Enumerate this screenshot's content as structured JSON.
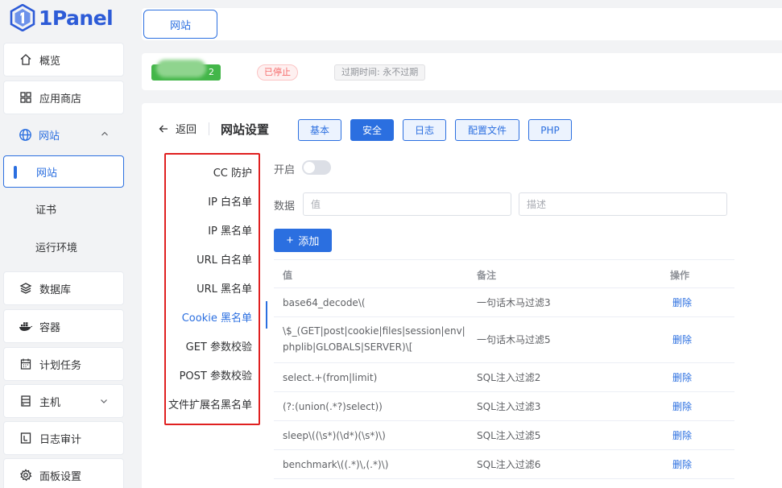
{
  "brand": {
    "name": "1Panel",
    "color": "#2d5bd7"
  },
  "sidebar": {
    "items": [
      {
        "label": "概览",
        "icon": "home-icon"
      },
      {
        "label": "应用商店",
        "icon": "grid-icon"
      },
      {
        "label": "网站",
        "icon": "globe-icon",
        "expanded": true
      },
      {
        "label": "数据库",
        "icon": "database-icon"
      },
      {
        "label": "容器",
        "icon": "docker-icon"
      },
      {
        "label": "计划任务",
        "icon": "calendar-icon"
      },
      {
        "label": "主机",
        "icon": "server-icon"
      },
      {
        "label": "日志审计",
        "icon": "log-icon"
      },
      {
        "label": "面板设置",
        "icon": "gear-icon"
      }
    ],
    "website_children": [
      {
        "label": "网站",
        "active": true
      },
      {
        "label": "证书"
      },
      {
        "label": "运行环境"
      }
    ]
  },
  "top_tab": {
    "label": "网站"
  },
  "site_info": {
    "tag_suffix": "2",
    "status": "已停止",
    "expire": "过期时间: 永不过期"
  },
  "header": {
    "back_label": "返回",
    "title": "网站设置",
    "tabs": [
      {
        "label": "基本",
        "active": false
      },
      {
        "label": "安全",
        "active": true
      },
      {
        "label": "日志",
        "active": false
      },
      {
        "label": "配置文件",
        "active": false
      },
      {
        "label": "PHP",
        "active": false
      }
    ]
  },
  "security_nav": [
    {
      "label": "CC 防护"
    },
    {
      "label": "IP 白名单"
    },
    {
      "label": "IP 黑名单"
    },
    {
      "label": "URL 白名单"
    },
    {
      "label": "URL 黑名单"
    },
    {
      "label": "Cookie 黑名单",
      "active": true
    },
    {
      "label": "GET 参数校验"
    },
    {
      "label": "POST 参数校验"
    },
    {
      "label": "文件扩展名黑名单"
    }
  ],
  "form": {
    "enable_label": "开启",
    "enabled": false,
    "data_label": "数据",
    "value_placeholder": "值",
    "desc_placeholder": "描述",
    "add_label": "添加"
  },
  "table": {
    "columns": [
      "值",
      "备注",
      "操作"
    ],
    "rows": [
      {
        "value": "base64_decode\\(",
        "note": "一句话木马过滤3",
        "action": "删除"
      },
      {
        "value": "\\$_(GET|post|cookie|files|session|env|phplib|GLOBALS|SERVER)\\[",
        "note": "一句话木马过滤5",
        "action": "删除"
      },
      {
        "value": "select.+(from|limit)",
        "note": "SQL注入过滤2",
        "action": "删除"
      },
      {
        "value": "(?:(union(.*?)select))",
        "note": "SQL注入过滤3",
        "action": "删除"
      },
      {
        "value": "sleep\\((\\s*)(\\d*)(\\s*)\\)",
        "note": "SQL注入过滤5",
        "action": "删除"
      },
      {
        "value": "benchmark\\((.*)\\,(.*)\\)",
        "note": "SQL注入过滤6",
        "action": "删除"
      }
    ]
  },
  "colors": {
    "accent": "#2b6fe0",
    "danger": "#f56c6c",
    "highlight_box": "#e02020"
  }
}
